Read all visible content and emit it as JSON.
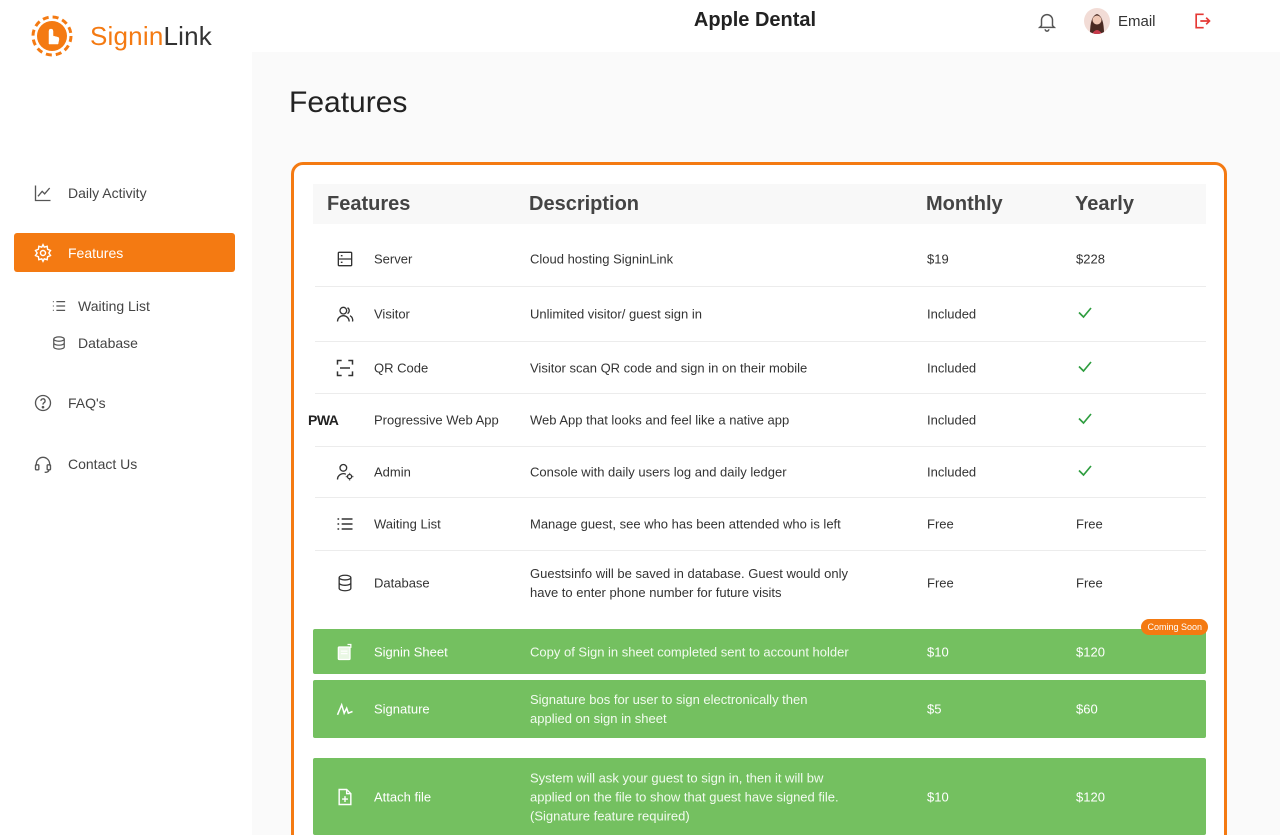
{
  "brand": {
    "name_part1": "Signin",
    "name_part2": "Link",
    "primary_color": "#f47a12",
    "green_color": "#74c060"
  },
  "header": {
    "company": "Apple Dental",
    "email_label": "Email",
    "bell_icon": "bell-icon",
    "logout_icon": "logout-icon"
  },
  "sidebar": {
    "items": [
      {
        "label": "Daily Activity",
        "icon": "chart-line-icon"
      },
      {
        "label": "Features",
        "icon": "gear-icon",
        "active": true
      },
      {
        "label": "Waiting List",
        "icon": "list-icon",
        "sub": true
      },
      {
        "label": "Database",
        "icon": "database-icon",
        "sub": true
      },
      {
        "label": "FAQ's",
        "icon": "help-icon"
      },
      {
        "label": "Contact Us",
        "icon": "headset-icon"
      }
    ]
  },
  "page": {
    "title": "Features"
  },
  "table": {
    "headers": [
      "Features",
      "Description",
      "Monthly",
      "Yearly"
    ],
    "rows": [
      {
        "icon": "server-icon",
        "name": "Server",
        "desc": "Cloud hosting SigninLink",
        "monthly": "$19",
        "yearly": "$228"
      },
      {
        "icon": "users-icon",
        "name": "Visitor",
        "desc": "Unlimited visitor/ guest sign in",
        "monthly": "Included",
        "yearly": "check"
      },
      {
        "icon": "qr-scan-icon",
        "name": "QR Code",
        "desc": "Visitor scan QR code and sign in on their mobile",
        "monthly": "Included",
        "yearly": "check"
      },
      {
        "icon": "pwa-icon",
        "name": "Progressive Web App",
        "desc": "Web App that looks and feel like a native app",
        "monthly": "Included",
        "yearly": "check"
      },
      {
        "icon": "admin-icon",
        "name": "Admin",
        "desc": "Console with daily users log and daily ledger",
        "monthly": "Included",
        "yearly": "check"
      },
      {
        "icon": "list-icon",
        "name": "Waiting List",
        "desc": "Manage guest, see who has been attended who is left",
        "monthly": "Free",
        "yearly": "Free"
      },
      {
        "icon": "database-icon",
        "name": "Database",
        "desc": "Guestsinfo will be saved in database. Guest would only have to enter phone number for future visits",
        "monthly": "Free",
        "yearly": "Free"
      }
    ],
    "pwa_logo_text": "PWA",
    "addons": [
      {
        "icon": "sheet-icon",
        "name": "Signin Sheet",
        "desc": "Copy of Sign in sheet completed sent to account holder",
        "monthly": "$10",
        "yearly": "$120",
        "badge": "Coming Soon"
      },
      {
        "icon": "signature-icon",
        "name": "Signature",
        "desc": "Signature bos for user to sign electronically then applied on sign in sheet",
        "monthly": "$5",
        "yearly": "$60"
      },
      {
        "icon": "file-plus-icon",
        "name": "Attach file",
        "desc": "System will ask your guest to sign in, then it will bw applied on the file to show that guest have signed file. (Signature feature required)",
        "monthly": "$10",
        "yearly": "$120"
      }
    ]
  }
}
